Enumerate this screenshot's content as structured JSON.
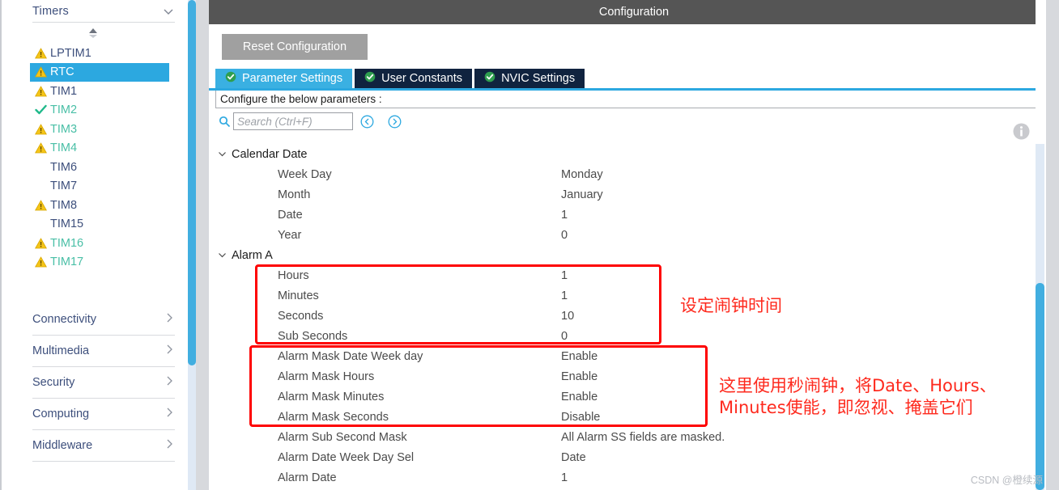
{
  "sidebar": {
    "header": {
      "title": "Timers",
      "chevron_icon": "chevron-down-icon"
    },
    "spinner_icon": "sort-spinner-icon",
    "items": [
      {
        "label": "LPTIM1",
        "status": "warning",
        "color": "blue",
        "selected": false
      },
      {
        "label": "RTC",
        "status": "warning",
        "color": "blue",
        "selected": true
      },
      {
        "label": "TIM1",
        "status": "warning",
        "color": "blue",
        "selected": false
      },
      {
        "label": "TIM2",
        "status": "ok",
        "color": "teal",
        "selected": false
      },
      {
        "label": "TIM3",
        "status": "warning",
        "color": "teal",
        "selected": false
      },
      {
        "label": "TIM4",
        "status": "warning",
        "color": "teal",
        "selected": false
      },
      {
        "label": "TIM6",
        "status": "none",
        "color": "blue",
        "selected": false
      },
      {
        "label": "TIM7",
        "status": "none",
        "color": "blue",
        "selected": false
      },
      {
        "label": "TIM8",
        "status": "warning",
        "color": "blue",
        "selected": false
      },
      {
        "label": "TIM15",
        "status": "none",
        "color": "blue",
        "selected": false
      },
      {
        "label": "TIM16",
        "status": "warning",
        "color": "teal",
        "selected": false
      },
      {
        "label": "TIM17",
        "status": "warning",
        "color": "teal",
        "selected": false
      }
    ],
    "groups": [
      {
        "label": "Connectivity",
        "chevron_icon": "chevron-right-icon"
      },
      {
        "label": "Multimedia",
        "chevron_icon": "chevron-right-icon"
      },
      {
        "label": "Security",
        "chevron_icon": "chevron-right-icon"
      },
      {
        "label": "Computing",
        "chevron_icon": "chevron-right-icon"
      },
      {
        "label": "Middleware",
        "chevron_icon": "chevron-right-icon"
      }
    ]
  },
  "main": {
    "title": "Configuration",
    "reset_button": "Reset Configuration",
    "tabs": [
      {
        "label": "Parameter Settings",
        "active": true,
        "icon": "check-circle-icon"
      },
      {
        "label": "User Constants",
        "active": false,
        "icon": "check-circle-icon"
      },
      {
        "label": "NVIC Settings",
        "active": false,
        "icon": "check-circle-icon"
      }
    ],
    "hint": "Configure the below parameters :",
    "search": {
      "icon": "search-icon",
      "placeholder": "Search (Ctrl+F)",
      "value": "",
      "prev_icon": "navigate-back-icon",
      "next_icon": "navigate-forward-icon"
    },
    "info_icon": "info-icon"
  },
  "tree": {
    "groups": [
      {
        "label": "Calendar Date",
        "expanded": true,
        "chevron_icon": "chevron-down-icon",
        "rows": [
          {
            "name": "Week Day",
            "value": "Monday"
          },
          {
            "name": "Month",
            "value": "January"
          },
          {
            "name": "Date",
            "value": "1"
          },
          {
            "name": "Year",
            "value": "0"
          }
        ]
      },
      {
        "label": "Alarm A",
        "expanded": true,
        "chevron_icon": "chevron-down-icon",
        "rows": [
          {
            "name": "Hours",
            "value": "1"
          },
          {
            "name": "Minutes",
            "value": "1"
          },
          {
            "name": "Seconds",
            "value": "10"
          },
          {
            "name": "Sub Seconds",
            "value": "0"
          },
          {
            "name": "Alarm Mask Date Week day",
            "value": "Enable"
          },
          {
            "name": "Alarm Mask Hours",
            "value": "Enable"
          },
          {
            "name": "Alarm Mask Minutes",
            "value": "Enable"
          },
          {
            "name": "Alarm Mask Seconds",
            "value": "Disable"
          },
          {
            "name": "Alarm Sub Second Mask",
            "value": "All Alarm SS fields are masked."
          },
          {
            "name": "Alarm Date Week Day Sel",
            "value": "Date"
          },
          {
            "name": "Alarm Date",
            "value": "1"
          }
        ]
      }
    ]
  },
  "annotations": {
    "note_1": "设定闹钟时间",
    "note_2_line_1": "这里使用秒闹钟，将Date、Hours、",
    "note_2_line_2": "Minutes使能，即忽视、掩盖它们",
    "box_color": "#fe0000",
    "text_color": "#fe2a1e"
  },
  "watermark": "CSDN @橙续源",
  "colors": {
    "accent_blue": "#2ca8e0",
    "tab_active": "#3ab0e2",
    "tab_inactive": "#10233f",
    "titlebar": "#555555",
    "sidebar_text": "#3d4f7c",
    "teal_text": "#49bfa6",
    "warning_yellow": "#f5c518"
  }
}
